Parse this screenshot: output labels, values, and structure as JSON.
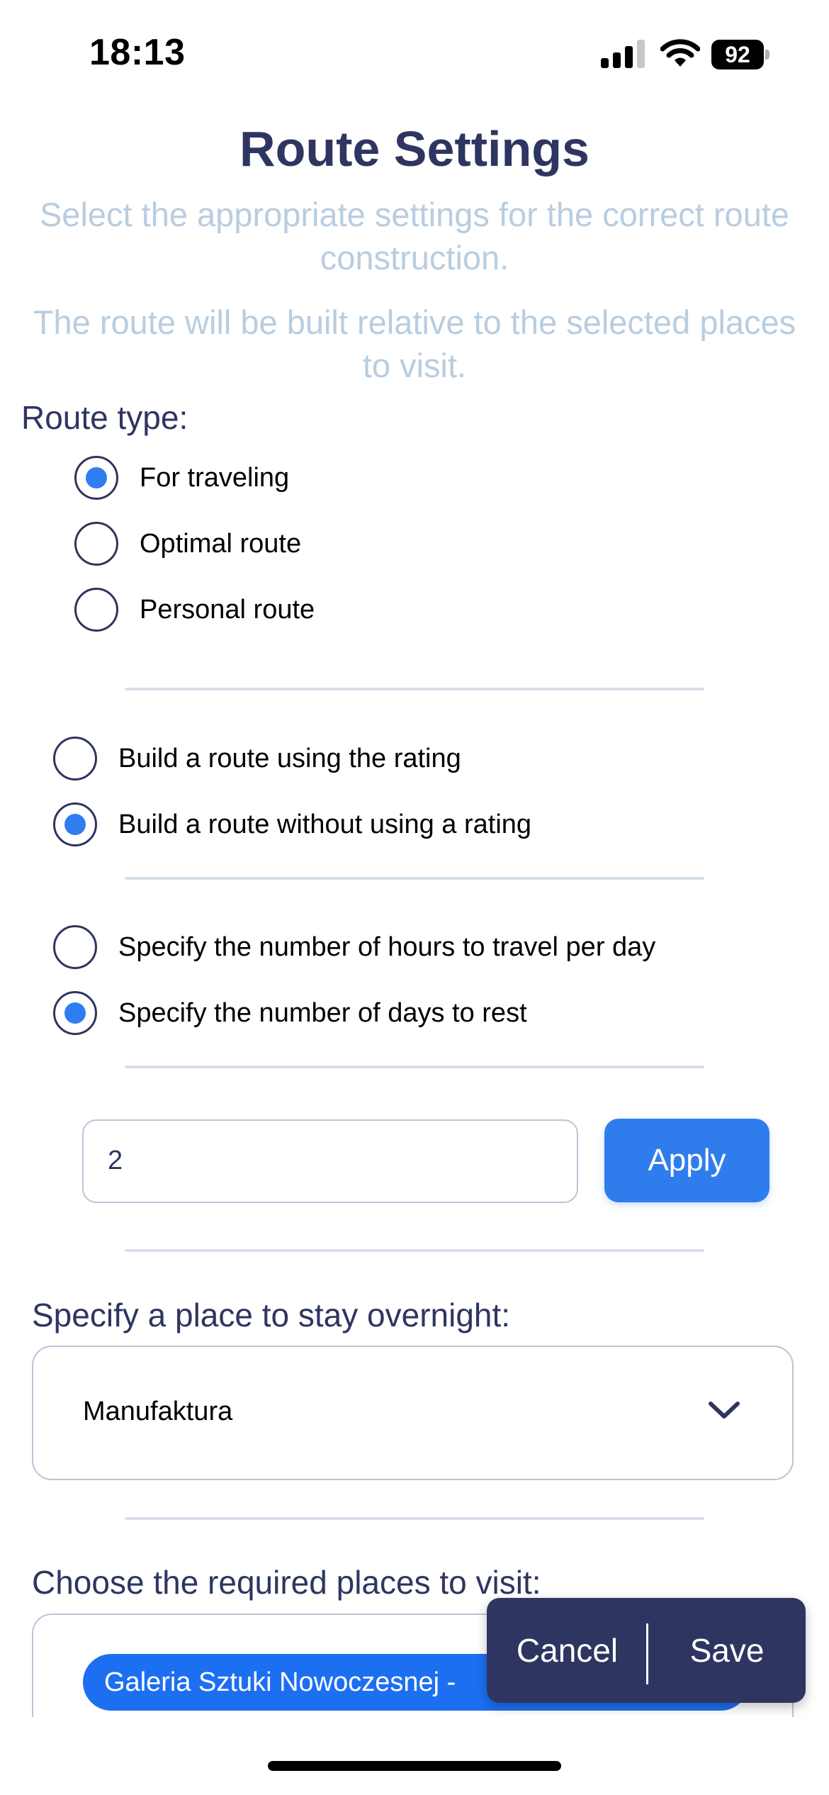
{
  "status_bar": {
    "time": "18:13",
    "battery_level": "92",
    "icons": [
      "cellular-signal-icon",
      "wifi-icon",
      "battery-icon"
    ]
  },
  "header": {
    "title": "Route Settings",
    "subtitle_1": "Select the appropriate settings for the correct route construction.",
    "subtitle_2": "The route will be built relative to the selected places to visit."
  },
  "route_type": {
    "label": "Route type:",
    "options": [
      {
        "label": "For traveling",
        "checked": true
      },
      {
        "label": "Optimal route",
        "checked": false
      },
      {
        "label": "Personal route",
        "checked": false
      }
    ]
  },
  "rating_mode": {
    "options": [
      {
        "label": "Build a route using the rating",
        "checked": false
      },
      {
        "label": "Build a route without using a rating",
        "checked": true
      }
    ]
  },
  "time_mode": {
    "options": [
      {
        "label": "Specify the number of hours to travel per day",
        "checked": false
      },
      {
        "label": "Specify the number of days to rest",
        "checked": true
      }
    ]
  },
  "days_input": {
    "value": "2",
    "apply_label": "Apply"
  },
  "overnight": {
    "label": "Specify a place to stay overnight:",
    "selected": "Manufaktura",
    "icon": "chevron-down-icon"
  },
  "places": {
    "label": "Choose the required places to visit:",
    "chips": [
      "Galeria Sztuki Nowoczesnej -"
    ]
  },
  "actions": {
    "cancel_label": "Cancel",
    "save_label": "Save"
  },
  "colors": {
    "primary_dark": "#2e3560",
    "accent_blue": "#2f7df1",
    "subtitle": "#b8cde0",
    "divider": "#d8e0ea"
  }
}
